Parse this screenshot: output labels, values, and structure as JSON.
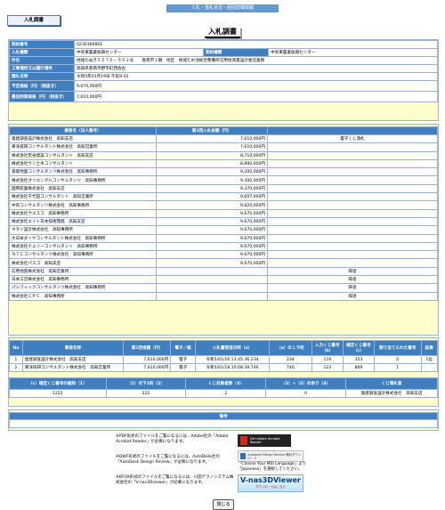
{
  "page": {
    "top_bar": "入札・落札状況・個別詳細情報",
    "tab": "入札調書",
    "title": "入札調書",
    "close_button": "閉じる"
  },
  "info": [
    {
      "label": "契約番号",
      "value": "0230360801"
    },
    {
      "label": "入札機関",
      "value": "中央東農業振興センター",
      "label2": "契約機関",
      "value2": "中央東農業振興センター"
    },
    {
      "label": "件名",
      "value": "地域たぬき５５７０－５０２号　　香南市ｌ期　地区　地域ため池総合整備県営用地測量設計委託業務"
    },
    {
      "label": "工事場所又は履行場所",
      "value": "高知県香南市野市町西佐古"
    },
    {
      "label": "開札日時",
      "value": "令和5年01月19日 午前9:02"
    },
    {
      "label": "予定価格（円）（税抜き）",
      "value": "9,670,000円"
    },
    {
      "label": "最低制限価格（円）（税抜き）",
      "value": "7,610,000円"
    }
  ],
  "bids": {
    "headers": [
      "業者名（法人番号）",
      "第1回入札金額（円）",
      ""
    ],
    "rows": [
      {
        "name": "復建調査設計株式会社　高知支店",
        "amount": "7,610,000円",
        "note": "電子くじ落札"
      },
      {
        "name": "東洋技研コンサルタント株式会社　高知営業所",
        "amount": "7,610,000円",
        "note": ""
      },
      {
        "name": "株式会社荒谷建設コンサルタント　高知支店",
        "amount": "8,710,000円",
        "note": ""
      },
      {
        "name": "株式会社サン土木コンサルタント",
        "amount": "8,890,000円",
        "note": ""
      },
      {
        "name": "基礎地盤コンサルタンツ株式会社　高知事務所",
        "amount": "9,200,000円",
        "note": ""
      },
      {
        "name": "株式会社オリエンタルコンサルタンツ　高知事務所",
        "amount": "9,300,000円",
        "note": ""
      },
      {
        "name": "国際航業株式会社　高知支店",
        "amount": "9,370,000円",
        "note": ""
      },
      {
        "name": "株式会社千代田コンサルタント　高知営業所",
        "amount": "9,607,000円",
        "note": ""
      },
      {
        "name": "中央コンサルタンツ株式会社　高知事務所",
        "amount": "9,620,000円",
        "note": ""
      },
      {
        "name": "株式会社ウエスコ　高知事務所",
        "amount": "9,670,000円",
        "note": ""
      },
      {
        "name": "株式会社エイト日本技術開発　高知支店",
        "amount": "9,670,000円",
        "note": ""
      },
      {
        "name": "キタイ設計株式会社　高知事務所",
        "amount": "9,670,000円",
        "note": ""
      },
      {
        "name": "大日本ダイヤコンサルタント株式会社　高知事務所",
        "amount": "9,670,000円",
        "note": ""
      },
      {
        "name": "株式会社チェリーコンサルタント　高知事務所",
        "amount": "9,670,000円",
        "note": ""
      },
      {
        "name": "ＮＴＣコンサルタンツ株式会社　高知事務所",
        "amount": "9,670,000円",
        "note": ""
      },
      {
        "name": "株式会社パスコ　高知支店",
        "amount": "9,670,000円",
        "note": ""
      },
      {
        "name": "応用地質株式会社　高知営業所",
        "amount": "",
        "note": "辞退"
      },
      {
        "name": "日本工営株式会社　高知事務所",
        "amount": "",
        "note": "辞退"
      },
      {
        "name": "パシフィックコンサルタンツ株式会社　高知事務所",
        "amount": "",
        "note": "辞退"
      },
      {
        "name": "株式会社ＣＰＣ　高知事務所",
        "amount": "",
        "note": "辞退"
      }
    ]
  },
  "lottery": {
    "headers": [
      "No",
      "業者名称",
      "第1回金額（円）",
      "電子／紙",
      "入札書受信日時（a）",
      "（a）の１ラ桁",
      "入力くじ番号（b）",
      "確定くじ番号（c）",
      "割り当てられた番号",
      "結果"
    ],
    "rows": [
      [
        "1",
        "復建調査設計株式会社　高知支店",
        "7,610,000円",
        "電子",
        "令和5/01/16 13:45:36.234",
        "234",
        "119",
        "353",
        "0",
        "1位"
      ],
      [
        "2",
        "東洋技研コンサルタント株式会社　高知営業所",
        "7,610,000円",
        "電子",
        "令和5/01/18 10:08:39.746",
        "746",
        "123",
        "869",
        "1",
        ""
      ]
    ],
    "sum_headers": [
      "（c）確定くじ番号の総和（1）",
      "（1）の下1桁（2）",
      "くじ対象者数（3）",
      "（2）÷（3）の余り（4）",
      "くじ落札者"
    ],
    "sum_values": [
      "1222",
      "222",
      "2",
      "0",
      "復建調査設計株式会社　高知支店"
    ]
  },
  "remarks": {
    "header": "備考",
    "value": ""
  },
  "notes": [
    "※PDF形式のファイルをご覧になるには、Adobe社の「Adobe Acrobat Reader」が必要になります。",
    "※DWF形式のファイルをご覧になるには、AutoDesk社の「AutoDesk Design Review」が必要になります。",
    "※BFOX形式のファイルをご覧になるには、川田テクノシステム株式会社の「V-nas3Dviewer」が必要になります。"
  ],
  "banners": {
    "adobe": "Get Adobe Acrobat Reader",
    "autodesk": "Autodesk Design Review 無料ダウンロード",
    "autodesk_note": "「Choose Your MSI Language」より「Japanese」を選択してください。",
    "vnas": "V-nas3DViewer",
    "vnas_sub": "ダウンロードはこちら"
  }
}
